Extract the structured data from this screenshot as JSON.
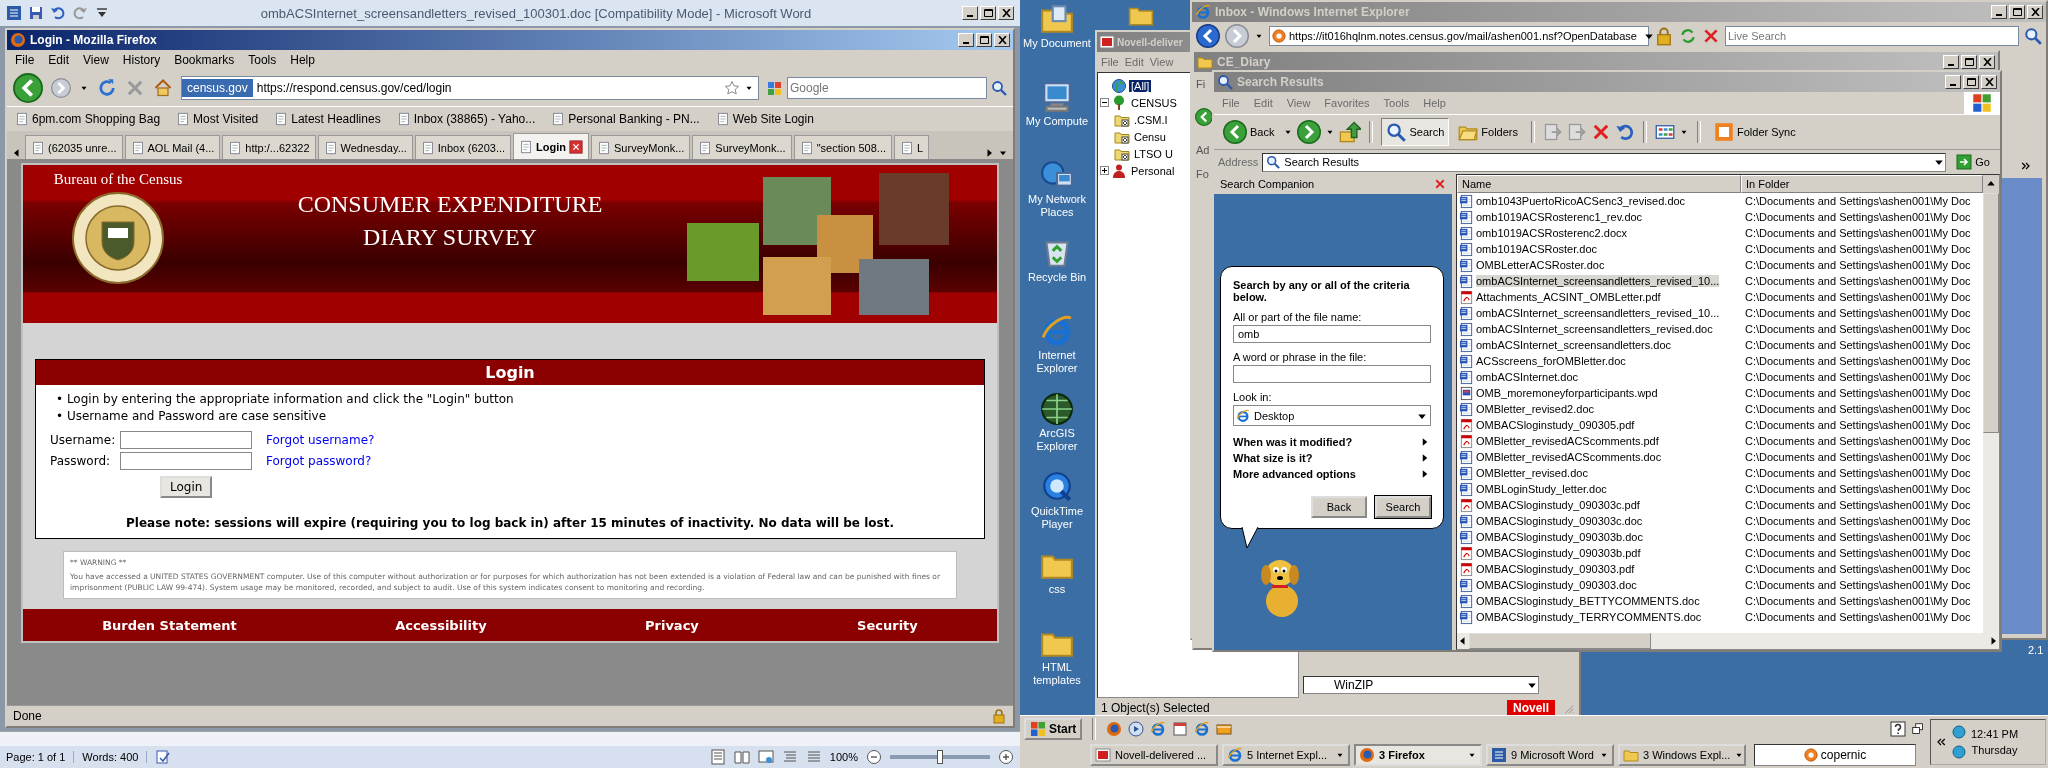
{
  "word_window": {
    "title": "ombACSInternet_screensandletters_revised_100301.doc [Compatibility Mode]  -  Microsoft Word",
    "status_bar": {
      "page": "Page: 1 of 1",
      "words": "Words: 400",
      "zoom": "100%",
      "zoom_slider": {
        "level": 0.5
      }
    }
  },
  "firefox": {
    "title": "Login - Mozilla Firefox",
    "menu": [
      "File",
      "Edit",
      "View",
      "History",
      "Bookmarks",
      "Tools",
      "Help"
    ],
    "identity": "census.gov",
    "url": "https://respond.census.gov/ced/login",
    "search_placeholder": "Google",
    "bookmarks": [
      "6pm.com Shopping Bag",
      "Most Visited",
      "Latest Headlines",
      "Inbox (38865) - Yaho...",
      "Personal Banking - PN...",
      "Web Site Login"
    ],
    "tabs": [
      {
        "label": "(62035 unre...",
        "selected": false
      },
      {
        "label": "AOL Mail (4...",
        "selected": false
      },
      {
        "label": "http:/...62322",
        "selected": false
      },
      {
        "label": "Wednesday...",
        "selected": false
      },
      {
        "label": "Inbox (6203...",
        "selected": false
      },
      {
        "label": "Login",
        "selected": true
      },
      {
        "label": "SurveyMonk...",
        "selected": false
      },
      {
        "label": "SurveyMonk...",
        "selected": false
      },
      {
        "label": "\"section 508...",
        "selected": false
      },
      {
        "label": "L",
        "selected": false
      }
    ],
    "status": "Done"
  },
  "census_page": {
    "agency": "Bureau of the Census",
    "title_lines": [
      "CONSUMER EXPENDITURE",
      "DIARY SURVEY"
    ],
    "login": {
      "heading": "Login",
      "bullet_marker": "•",
      "bullets": [
        "Login by entering the appropriate information and click the \"Login\" button",
        "Username and Password are case sensitive"
      ],
      "fields": [
        {
          "label": "Username:",
          "link": "Forgot username?"
        },
        {
          "label": "Password:",
          "link": "Forgot password?"
        }
      ],
      "button": "Login",
      "note": "Please note: sessions will expire (requiring you to log back in) after 15 minutes of inactivity. No data will be lost."
    },
    "warning": {
      "title": "** WARNING **",
      "text": "You have accessed a UNITED STATES GOVERNMENT computer. Use of this computer without authorization or for purposes for which authorization has not been extended is a violation of Federal law and can be punished with fines or imprisonment (PUBLIC LAW 99-474). System usage may be monitored, recorded, and subject to audit. Use of this system indicates consent to monitoring and recording."
    },
    "footer_links": [
      "Burden Statement",
      "Accessibility",
      "Privacy",
      "Security"
    ]
  },
  "desktop": {
    "icons": [
      {
        "label": "My Document",
        "kind": "documents"
      },
      {
        "label": "My Compute",
        "kind": "computer"
      },
      {
        "label": "My Network Places",
        "kind": "network"
      },
      {
        "label": "Recycle Bin",
        "kind": "recycle"
      },
      {
        "label": "Internet Explorer",
        "kind": "ie"
      },
      {
        "label": "ArcGIS Explorer",
        "kind": "arcgis"
      },
      {
        "label": "QuickTime Player",
        "kind": "quicktime"
      },
      {
        "label": "css",
        "kind": "folder"
      },
      {
        "label": "HTML templates",
        "kind": "folder"
      }
    ],
    "version_text": "2.1"
  },
  "novell_window": {
    "title": "Novell-deliver",
    "menu": [
      "File",
      "Edit",
      "View"
    ],
    "tree": [
      {
        "label": "[All]",
        "kind": "globe",
        "selected": true
      },
      {
        "label": "CENSUS",
        "kind": "tree",
        "selected": false,
        "expanded": true,
        "children": [
          {
            "label": ".CSM.I",
            "kind": "container",
            "selected": false
          },
          {
            "label": "Censu",
            "kind": "container",
            "selected": false
          },
          {
            "label": "LTSO U",
            "kind": "container",
            "selected": false
          }
        ]
      },
      {
        "label": "Personal",
        "kind": "person",
        "selected": false,
        "expanded": false
      }
    ],
    "dropdown": "WinZIP",
    "status": "1 Object(s) Selected",
    "logo": "Novell"
  },
  "ie_window": {
    "title": "Inbox - Windows Internet Explorer",
    "url": "https://it016hqlnm.notes.census.gov/mail/ashen001.nsf?OpenDatabase",
    "search_placeholder": "Live Search"
  },
  "ce_diary_window": {
    "title": "CE_Diary",
    "partial_labels": [
      "Fi",
      "Ad",
      "Fo"
    ]
  },
  "search_window": {
    "title": "Search Results",
    "menu": [
      "File",
      "Edit",
      "View",
      "Favorites",
      "Tools",
      "Help"
    ],
    "toolbar": [
      {
        "label": "Back",
        "kind": "back",
        "selected": false
      },
      {
        "label": "Search",
        "kind": "search",
        "selected": true
      },
      {
        "label": "Folders",
        "kind": "folders",
        "selected": false
      },
      {
        "label": "Folder Sync",
        "kind": "sync",
        "selected": false
      }
    ],
    "address_label": "Address",
    "address": "Search Results",
    "go": "Go",
    "companion": {
      "title": "Search Companion",
      "intro": "Search by any or all of the criteria below.",
      "fields": [
        {
          "label": "All or part of the file name:",
          "value": "omb"
        },
        {
          "label": "A word or phrase in the file:"
        }
      ],
      "look_in_label": "Look in:",
      "look_in": "Desktop",
      "options": [
        "When was it modified?",
        "What size is it?",
        "More advanced options"
      ],
      "buttons": [
        "Back",
        "Search"
      ]
    },
    "columns": [
      "Name",
      "In Folder"
    ],
    "rows": [
      {
        "name": "omb1043PuertoRicoACSenc3_revised.doc",
        "folder": "C:\\Documents and Settings\\ashen001\\My Doc",
        "kind": "doc",
        "selected": false
      },
      {
        "name": "omb1019ACSRosterenc1_rev.doc",
        "folder": "C:\\Documents and Settings\\ashen001\\My Doc",
        "kind": "doc",
        "selected": false
      },
      {
        "name": "omb1019ACSRosterenc2.docx",
        "folder": "C:\\Documents and Settings\\ashen001\\My Doc",
        "kind": "doc",
        "selected": false
      },
      {
        "name": "omb1019ACSRoster.doc",
        "folder": "C:\\Documents and Settings\\ashen001\\My Doc",
        "kind": "doc",
        "selected": false
      },
      {
        "name": "OMBLetterACSRoster.doc",
        "folder": "C:\\Documents and Settings\\ashen001\\My Doc",
        "kind": "doc",
        "selected": false
      },
      {
        "name": "ombACSInternet_screensandletters_revised_10...",
        "folder": "C:\\Documents and Settings\\ashen001\\My Doc",
        "kind": "doc",
        "selected": true
      },
      {
        "name": "Attachments_ACSINT_OMBLetter.pdf",
        "folder": "C:\\Documents and Settings\\ashen001\\My Doc",
        "kind": "pdf",
        "selected": false
      },
      {
        "name": "ombACSInternet_screensandletters_revised_10...",
        "folder": "C:\\Documents and Settings\\ashen001\\My Doc",
        "kind": "doc",
        "selected": false
      },
      {
        "name": "ombACSInternet_screensandletters_revised.doc",
        "folder": "C:\\Documents and Settings\\ashen001\\My Doc",
        "kind": "doc",
        "selected": false
      },
      {
        "name": "ombACSInternet_screensandletters.doc",
        "folder": "C:\\Documents and Settings\\ashen001\\My Doc",
        "kind": "doc",
        "selected": false
      },
      {
        "name": "ACSscreens_forOMBletter.doc",
        "folder": "C:\\Documents and Settings\\ashen001\\My Doc",
        "kind": "doc",
        "selected": false
      },
      {
        "name": "ombACSInternet.doc",
        "folder": "C:\\Documents and Settings\\ashen001\\My Doc",
        "kind": "doc",
        "selected": false
      },
      {
        "name": "OMB_moremoneyforparticipants.wpd",
        "folder": "C:\\Documents and Settings\\ashen001\\My Doc",
        "kind": "wpd",
        "selected": false
      },
      {
        "name": "OMBletter_revised2.doc",
        "folder": "C:\\Documents and Settings\\ashen001\\My Doc",
        "kind": "doc",
        "selected": false
      },
      {
        "name": "OMBACSloginstudy_090305.pdf",
        "folder": "C:\\Documents and Settings\\ashen001\\My Doc",
        "kind": "pdf",
        "selected": false
      },
      {
        "name": "OMBletter_revisedACScomments.pdf",
        "folder": "C:\\Documents and Settings\\ashen001\\My Doc",
        "kind": "pdf",
        "selected": false
      },
      {
        "name": "OMBletter_revisedACScomments.doc",
        "folder": "C:\\Documents and Settings\\ashen001\\My Doc",
        "kind": "doc",
        "selected": false
      },
      {
        "name": "OMBletter_revised.doc",
        "folder": "C:\\Documents and Settings\\ashen001\\My Doc",
        "kind": "doc",
        "selected": false
      },
      {
        "name": "OMBLoginStudy_letter.doc",
        "folder": "C:\\Documents and Settings\\ashen001\\My Doc",
        "kind": "doc",
        "selected": false
      },
      {
        "name": "OMBACSloginstudy_090303c.pdf",
        "folder": "C:\\Documents and Settings\\ashen001\\My Doc",
        "kind": "pdf",
        "selected": false
      },
      {
        "name": "OMBACSloginstudy_090303c.doc",
        "folder": "C:\\Documents and Settings\\ashen001\\My Doc",
        "kind": "doc",
        "selected": false
      },
      {
        "name": "OMBACSloginstudy_090303b.doc",
        "folder": "C:\\Documents and Settings\\ashen001\\My Doc",
        "kind": "doc",
        "selected": false
      },
      {
        "name": "OMBACSloginstudy_090303b.pdf",
        "folder": "C:\\Documents and Settings\\ashen001\\My Doc",
        "kind": "pdf",
        "selected": false
      },
      {
        "name": "OMBACSloginstudy_090303.pdf",
        "folder": "C:\\Documents and Settings\\ashen001\\My Doc",
        "kind": "pdf",
        "selected": false
      },
      {
        "name": "OMBACSloginstudy_090303.doc",
        "folder": "C:\\Documents and Settings\\ashen001\\My Doc",
        "kind": "doc",
        "selected": false
      },
      {
        "name": "OMBACSloginstudy_BETTYCOMMENTS.doc",
        "folder": "C:\\Documents and Settings\\ashen001\\My Doc",
        "kind": "doc",
        "selected": false
      },
      {
        "name": "OMBACSloginstudy_TERRYCOMMENTS.doc",
        "folder": "C:\\Documents and Settings\\ashen001\\My Doc",
        "kind": "doc",
        "selected": false
      }
    ]
  },
  "taskbar": {
    "start": "Start",
    "buttons": [
      {
        "label": "Novell-delivered ...",
        "kind": "novell",
        "selected": false,
        "grouped": false
      },
      {
        "label": "5 Internet Expl...",
        "kind": "ie",
        "selected": false,
        "grouped": true
      },
      {
        "label": "3 Firefox",
        "kind": "firefox",
        "selected": true,
        "grouped": true
      },
      {
        "label": "9 Microsoft Word",
        "kind": "word",
        "selected": false,
        "grouped": true
      },
      {
        "label": "3 Windows Expl...",
        "kind": "folder",
        "selected": false,
        "grouped": true
      }
    ],
    "search_value": "copernic",
    "clock": "12:41 PM",
    "day": "Thursday"
  }
}
